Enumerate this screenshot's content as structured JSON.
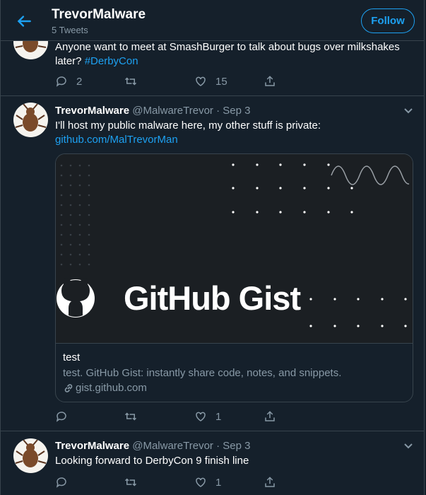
{
  "header": {
    "title": "TrevorMalware",
    "subtitle": "5 Tweets",
    "follow_label": "Follow"
  },
  "colors": {
    "accent": "#1da1f2",
    "background": "#15202b",
    "muted": "#8899a6",
    "border": "#38444d"
  },
  "tweets": [
    {
      "text_prefix": "Anyone want to meet at SmashBurger to talk about bugs over milkshakes later? ",
      "hashtag": "#DerbyCon",
      "reply_count": "2",
      "retweet_count": "",
      "like_count": "15"
    },
    {
      "name": "TrevorMalware",
      "handle": "@MalwareTrevor",
      "separator": "·",
      "date": "Sep 3",
      "text": "I'll host my public malware here, my other stuff is private:",
      "link": "github.com/MalTrevorMan",
      "card": {
        "image_text": "GitHub Gist",
        "title": "test",
        "description": "test. GitHub Gist: instantly share code, notes, and snippets.",
        "url": "gist.github.com"
      },
      "reply_count": "",
      "retweet_count": "",
      "like_count": "1"
    },
    {
      "name": "TrevorMalware",
      "handle": "@MalwareTrevor",
      "separator": "·",
      "date": "Sep 3",
      "text": "Looking forward to DerbyCon 9 finish line",
      "reply_count": "",
      "retweet_count": "",
      "like_count": "1"
    }
  ],
  "icons": [
    "back-arrow-icon",
    "reply-icon",
    "retweet-icon",
    "like-icon",
    "share-icon",
    "chevron-down-icon",
    "link-icon",
    "github-logo-icon",
    "cockroach-avatar"
  ]
}
